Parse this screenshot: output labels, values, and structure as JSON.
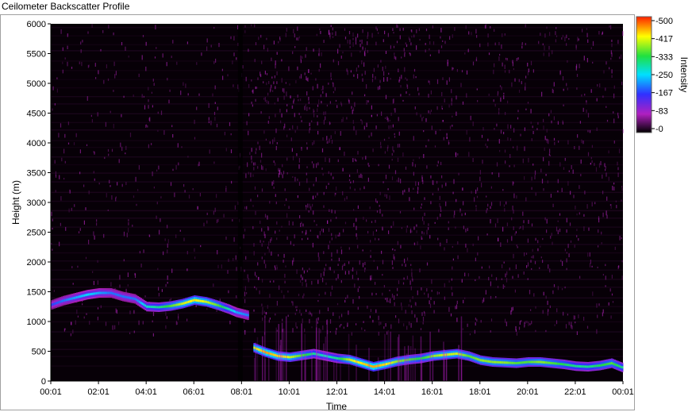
{
  "window": {
    "title": "Ceilometer Backscatter Profile"
  },
  "chart_data": {
    "type": "heatmap",
    "title": "",
    "xlabel": "Time",
    "ylabel": "Height (m)",
    "x_ticks": [
      "00:01",
      "02:01",
      "04:01",
      "06:01",
      "08:01",
      "10:01",
      "12:01",
      "14:01",
      "16:01",
      "18:01",
      "20:01",
      "22:01",
      "00:01"
    ],
    "y_ticks": [
      "0",
      "500",
      "1000",
      "1500",
      "2000",
      "2500",
      "3000",
      "3500",
      "4000",
      "4500",
      "5000",
      "5500",
      "6000"
    ],
    "xlim_hours": [
      0,
      24
    ],
    "ylim": [
      0,
      6000
    ],
    "colorbar": {
      "label": "Intensity",
      "ticks": [
        "-500",
        "-417",
        "-333",
        "-250",
        "-167",
        "-83",
        "-0"
      ],
      "range": [
        0,
        500
      ],
      "colors": [
        "#000000",
        "#b020c0",
        "#3030ff",
        "#00e0ff",
        "#20e040",
        "#ffff00",
        "#ff2000"
      ]
    },
    "cloud_layer": {
      "hours": [
        0.0,
        0.5,
        1.0,
        1.5,
        2.0,
        2.5,
        3.0,
        3.5,
        4.0,
        4.5,
        5.0,
        5.5,
        6.0,
        6.5,
        7.0,
        7.5,
        7.8,
        8.3,
        8.5,
        9.0,
        9.5,
        10.0,
        10.5,
        11.0,
        11.5,
        12.0,
        12.5,
        13.0,
        13.5,
        14.0,
        14.5,
        15.0,
        15.5,
        16.0,
        16.5,
        17.0,
        17.5,
        18.0,
        18.5,
        19.0,
        19.5,
        20.0,
        20.5,
        21.0,
        21.5,
        22.0,
        22.5,
        23.0,
        23.5,
        24.0
      ],
      "heights": [
        1280,
        1350,
        1400,
        1450,
        1480,
        1480,
        1420,
        1380,
        1250,
        1240,
        1260,
        1300,
        1360,
        1330,
        1270,
        1200,
        1150,
        1100,
        560,
        480,
        420,
        400,
        430,
        460,
        420,
        380,
        360,
        300,
        240,
        280,
        330,
        360,
        380,
        420,
        440,
        460,
        420,
        350,
        320,
        310,
        300,
        320,
        320,
        300,
        280,
        250,
        240,
        260,
        300,
        220
      ],
      "strength": [
        0.35,
        0.4,
        0.45,
        0.5,
        0.45,
        0.4,
        0.4,
        0.4,
        0.55,
        0.6,
        0.7,
        0.8,
        0.85,
        0.8,
        0.7,
        0.55,
        0.45,
        0.4,
        0.8,
        0.9,
        0.85,
        0.8,
        0.7,
        0.6,
        0.55,
        0.6,
        0.8,
        0.85,
        0.9,
        0.85,
        0.75,
        0.7,
        0.65,
        0.75,
        0.8,
        0.8,
        0.7,
        0.75,
        0.75,
        0.75,
        0.7,
        0.7,
        0.75,
        0.7,
        0.65,
        0.6,
        0.6,
        0.65,
        0.7,
        0.6
      ]
    }
  }
}
